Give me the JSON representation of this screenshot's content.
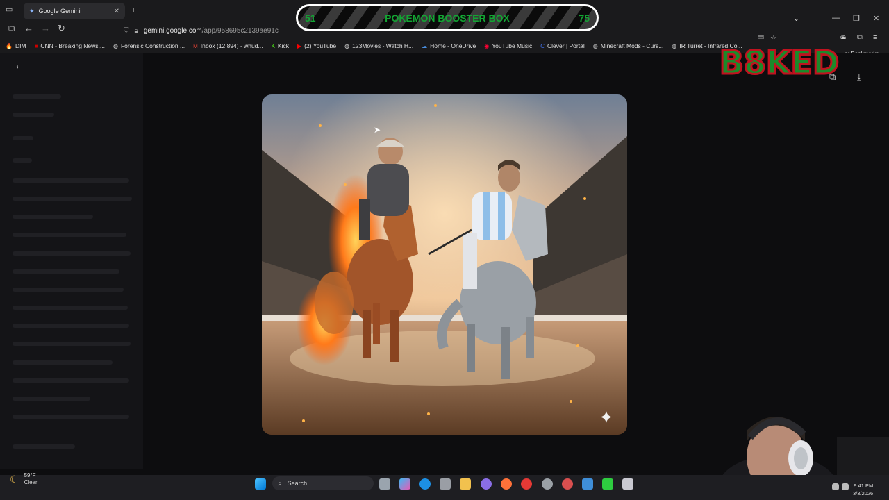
{
  "browser": {
    "tab_title": "Google Gemini",
    "tab_close": "✕",
    "new_tab": "+",
    "url_host": "gemini.google.com",
    "url_path": "/app/958695c2139ae91c",
    "other_bookmarks": "er Bookmarks"
  },
  "bookmarks": [
    {
      "label": "DIM",
      "icon": "flame-icon",
      "glyph": "🔥",
      "color": "#e67e22"
    },
    {
      "label": "CNN - Breaking News,...",
      "icon": "cnn-icon",
      "glyph": "■",
      "color": "#cc0000"
    },
    {
      "label": "Forensic Construction ...",
      "icon": "globe-icon",
      "glyph": "◍",
      "color": "#cccccc"
    },
    {
      "label": "Inbox (12,894) - whud...",
      "icon": "gmail-icon",
      "glyph": "M",
      "color": "#ea4335"
    },
    {
      "label": "Kick",
      "icon": "kick-icon",
      "glyph": "K",
      "color": "#53fc18"
    },
    {
      "label": "(2) YouTube",
      "icon": "youtube-icon",
      "glyph": "▶",
      "color": "#ff0000"
    },
    {
      "label": "123Movies - Watch H...",
      "icon": "globe-icon",
      "glyph": "◍",
      "color": "#cccccc"
    },
    {
      "label": "Home - OneDrive",
      "icon": "onedrive-icon",
      "glyph": "☁",
      "color": "#4a90e2"
    },
    {
      "label": "YouTube Music",
      "icon": "youtube-music-icon",
      "glyph": "◉",
      "color": "#ff0033"
    },
    {
      "label": "Clever | Portal",
      "icon": "clever-icon",
      "glyph": "C",
      "color": "#4274f6"
    },
    {
      "label": "Minecraft Mods - Curs...",
      "icon": "globe-icon",
      "glyph": "◍",
      "color": "#cccccc"
    },
    {
      "label": "IR Turret - Infrared Co...",
      "icon": "globe-icon",
      "glyph": "◍",
      "color": "#cccccc"
    }
  ],
  "overlay": {
    "left_count": "51",
    "title": "POKEMON BOOSTER BOX",
    "right_count": "75"
  },
  "logo_text": "B8KED",
  "taskbar": {
    "weather_temp": "59°F",
    "weather_desc": "Clear",
    "search_label": "Search",
    "time": "9:41 PM",
    "date": "3/3/2026"
  },
  "colors": {
    "banner_text": "#13a533",
    "logo_green": "#1b8a2a",
    "logo_red": "#c0121f",
    "logo_yellow": "#f5c518"
  }
}
